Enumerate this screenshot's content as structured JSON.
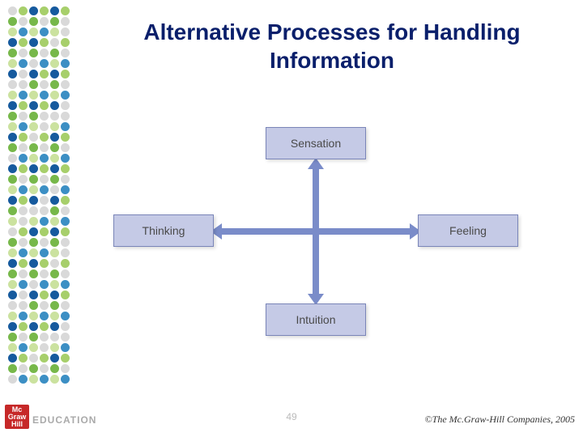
{
  "title": "Alternative Processes for Handling Information",
  "diagram": {
    "top": "Sensation",
    "bottom": "Intuition",
    "left": "Thinking",
    "right": "Feeling"
  },
  "footer": {
    "logo_line1": "Mc",
    "logo_line2": "Graw",
    "logo_line3": "Hill",
    "brand": "EDUCATION",
    "page": "49",
    "copyright": "©The Mc.Graw-Hill Companies, 2005"
  },
  "dot_palette": [
    "#165a9e",
    "#3c8fc4",
    "#77b84a",
    "#a7cf6b",
    "#cbe29f",
    "#d9d9d9"
  ]
}
